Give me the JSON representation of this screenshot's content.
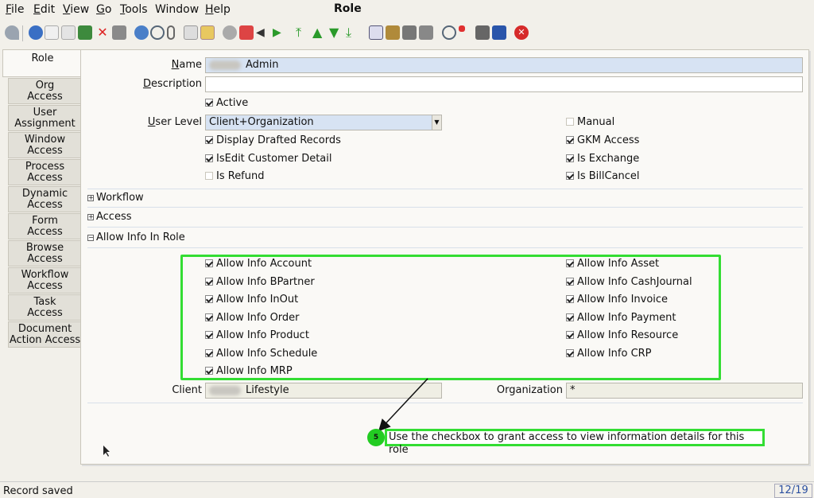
{
  "menu": {
    "items": [
      {
        "underline": "F",
        "rest": "ile"
      },
      {
        "underline": "E",
        "rest": "dit"
      },
      {
        "underline": "V",
        "rest": "iew"
      },
      {
        "underline": "G",
        "rest": "o"
      },
      {
        "underline": "T",
        "rest": "ools"
      },
      {
        "underline": "",
        "rest": "Window"
      },
      {
        "underline": "H",
        "rest": "elp"
      }
    ],
    "title": "Role"
  },
  "tabs": [
    {
      "label": "Role",
      "active": true
    },
    {
      "label": "Org\nAccess"
    },
    {
      "label": "User\nAssignment"
    },
    {
      "label": "Window\nAccess"
    },
    {
      "label": "Process\nAccess"
    },
    {
      "label": "Dynamic\nAccess"
    },
    {
      "label": "Form\nAccess"
    },
    {
      "label": "Browse\nAccess"
    },
    {
      "label": "Workflow\nAccess"
    },
    {
      "label": "Task\nAccess"
    },
    {
      "label": "Document\nAction Access"
    }
  ],
  "form": {
    "name_label_u": "N",
    "name_label_rest": "ame",
    "name_value": "Admin",
    "desc_label_u": "D",
    "desc_label_rest": "escription",
    "desc_value": "",
    "active_label": "Active",
    "user_level_label_u": "U",
    "user_level_label_rest": "ser Level",
    "user_level_value": "Client+Organization",
    "manual_label": "Manual",
    "display_drafted_label": "Display Drafted Records",
    "gkm_label": "GKM Access",
    "isedit_label": "IsEdit Customer Detail",
    "is_exchange_label": "Is Exchange",
    "is_refund_label": "Is Refund",
    "is_billcancel_label": "Is BillCancel",
    "client_label": "Client",
    "client_value": "Lifestyle",
    "org_label": "Organization",
    "org_value": "*"
  },
  "sections": {
    "workflow": "Workflow",
    "access": "Access",
    "allow_info": "Allow Info In Role"
  },
  "allow_info": {
    "left": [
      "Allow Info Account",
      "Allow Info BPartner",
      "Allow Info InOut",
      "Allow Info Order",
      "Allow Info Product",
      "Allow Info Schedule",
      "Allow Info MRP"
    ],
    "right": [
      "Allow Info Asset",
      "Allow Info CashJournal",
      "Allow Info Invoice",
      "Allow Info Payment",
      "Allow Info Resource",
      "Allow Info CRP"
    ]
  },
  "callout": {
    "step": "5",
    "text": "Use the checkbox to grant access to view information details for this role"
  },
  "status": {
    "text": "Record saved",
    "count": "12/19"
  },
  "colors": {
    "highlight": "#33dd33",
    "mandatory": "#d7e3f3"
  }
}
